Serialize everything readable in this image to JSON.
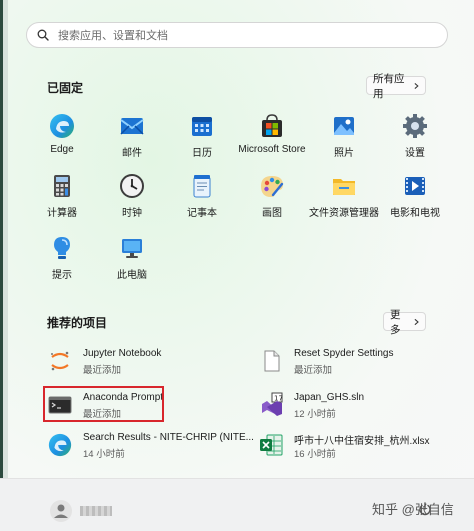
{
  "search": {
    "placeholder": "搜索应用、设置和文档"
  },
  "pinned": {
    "title": "已固定",
    "all_apps_label": "所有应用",
    "apps": [
      {
        "label": "Edge",
        "icon": "edge-icon"
      },
      {
        "label": "邮件",
        "icon": "mail-icon"
      },
      {
        "label": "日历",
        "icon": "calendar-icon"
      },
      {
        "label": "Microsoft Store",
        "icon": "store-icon"
      },
      {
        "label": "照片",
        "icon": "photos-icon"
      },
      {
        "label": "设置",
        "icon": "settings-icon"
      },
      {
        "label": "计算器",
        "icon": "calculator-icon"
      },
      {
        "label": "时钟",
        "icon": "clock-icon"
      },
      {
        "label": "记事本",
        "icon": "notepad-icon"
      },
      {
        "label": "画图",
        "icon": "paint-icon"
      },
      {
        "label": "文件资源管理器",
        "icon": "folder-icon"
      },
      {
        "label": "电影和电视",
        "icon": "movies-icon"
      },
      {
        "label": "提示",
        "icon": "tips-icon"
      },
      {
        "label": "此电脑",
        "icon": "this-pc-icon"
      }
    ]
  },
  "recommended": {
    "title": "推荐的项目",
    "more_label": "更多",
    "items": [
      {
        "name": "Jupyter Notebook",
        "sub": "最近添加",
        "icon": "jupyter-icon"
      },
      {
        "name": "Reset Spyder Settings",
        "sub": "最近添加",
        "icon": "document-icon"
      },
      {
        "name": "Anaconda Prompt",
        "sub": "最近添加",
        "icon": "terminal-icon"
      },
      {
        "name": "Japan_GHS.sln",
        "sub": "12 小时前",
        "icon": "visual-studio-solution-icon"
      },
      {
        "name": "Search Results - NITE-CHRIP (NITE...",
        "sub": "14 小时前",
        "icon": "edge-icon"
      },
      {
        "name": "呼市十八中住宿安排_杭州.xlsx",
        "sub": "16 小时前",
        "icon": "excel-icon"
      }
    ]
  },
  "footer": {
    "watermark": "知乎 @张自信"
  },
  "colors": {
    "highlight": "#d8262c",
    "accent": "#0f6cbd"
  }
}
